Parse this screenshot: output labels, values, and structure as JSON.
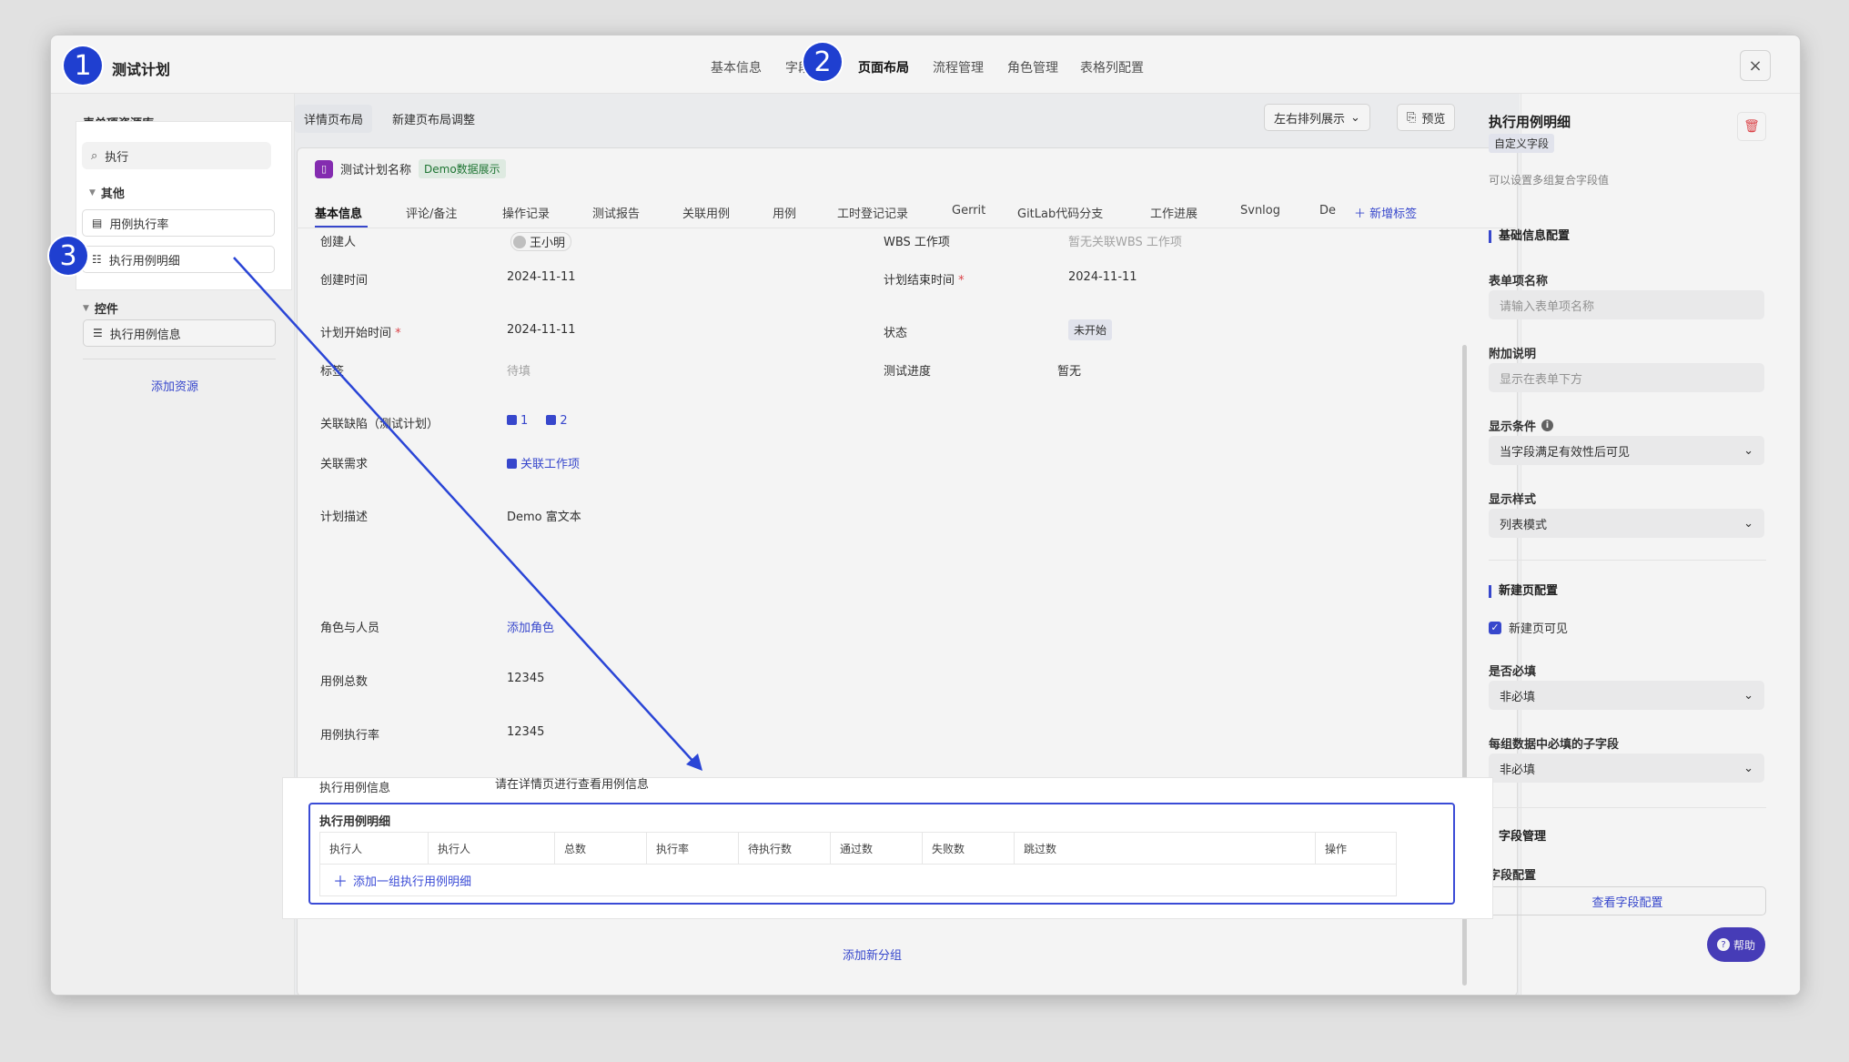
{
  "header": {
    "title": "测试计划",
    "nav": [
      "基本信息",
      "字段",
      "页面布局",
      "流程管理",
      "角色管理",
      "表格列配置"
    ],
    "active_nav": "页面布局",
    "close": "×"
  },
  "badges": [
    "1",
    "2",
    "3"
  ],
  "left_panel": {
    "title": "表单项资源库",
    "search_value": "执行",
    "group_other": "其他",
    "other_items": [
      "用例执行率",
      "执行用例明细"
    ],
    "group_control": "控件",
    "control_items": [
      "执行用例信息"
    ],
    "add_resource": "添加资源"
  },
  "layout_tabs": [
    "详情页布局",
    "新建页布局调整"
  ],
  "toolbar": {
    "arrange": "左右排列展示",
    "preview": "预览"
  },
  "detail": {
    "name": "测试计划名称",
    "demo_tag": "Demo数据展示",
    "tabs": [
      "基本信息",
      "评论/备注",
      "操作记录",
      "测试报告",
      "关联用例",
      "用例",
      "工时登记记录",
      "Gerrit",
      "GitLab代码分支",
      "工作进展",
      "Svnlog",
      "De"
    ],
    "add_tab": "新增标签",
    "fields": {
      "creator_label": "创建人",
      "creator_value": "王小明",
      "wbs_label": "WBS 工作项",
      "wbs_value": "暂无关联WBS 工作项",
      "created_label": "创建时间",
      "created_value": "2024-11-11",
      "plan_end_label": "计划结束时间",
      "plan_end_value": "2024-11-11",
      "plan_start_label": "计划开始时间",
      "plan_start_value": "2024-11-11",
      "status_label": "状态",
      "status_value": "未开始",
      "tag_label": "标签",
      "tag_value": "待填",
      "progress_label": "测试进度",
      "progress_value": "暂无",
      "defect_label": "关联缺陷（测试计划）",
      "defect_values": [
        "1",
        "2"
      ],
      "req_label": "关联需求",
      "req_value": "关联工作项",
      "desc_label": "计划描述",
      "desc_value": "Demo 富文本",
      "role_label": "角色与人员",
      "role_value": "添加角色",
      "total_label": "用例总数",
      "total_value": "12345",
      "rate_label": "用例执行率",
      "rate_value": "12345",
      "exec_info_label": "执行用例信息",
      "exec_info_value": "请在详情页进行查看用例信息"
    },
    "exec_table": {
      "title": "执行用例明细",
      "columns": [
        "执行人",
        "执行人",
        "总数",
        "执行率",
        "待执行数",
        "通过数",
        "失败数",
        "跳过数",
        "操作"
      ],
      "add_row": "添加一组执行用例明细"
    },
    "add_group": "添加新分组"
  },
  "right_panel": {
    "title": "执行用例明细",
    "type_tag": "自定义字段",
    "desc": "可以设置多组复合字段值",
    "basic_section": "基础信息配置",
    "name_label": "表单项名称",
    "name_placeholder": "请输入表单项名称",
    "note_label": "附加说明",
    "note_placeholder": "显示在表单下方",
    "cond_label": "显示条件",
    "cond_value": "当字段满足有效性后可见",
    "style_label": "显示样式",
    "style_value": "列表模式",
    "new_section": "新建页配置",
    "new_visible": "新建页可见",
    "required_label": "是否必填",
    "required_value": "非必填",
    "sub_required_label": "每组数据中必填的子字段",
    "sub_required_value": "非必填",
    "field_section": "字段管理",
    "field_config_label": "字段配置",
    "field_config_btn": "查看字段配置",
    "help": "帮助"
  },
  "colors": {
    "accent": "#3a4bd6",
    "badge": "#1f3fd0",
    "danger": "#e5484d"
  }
}
